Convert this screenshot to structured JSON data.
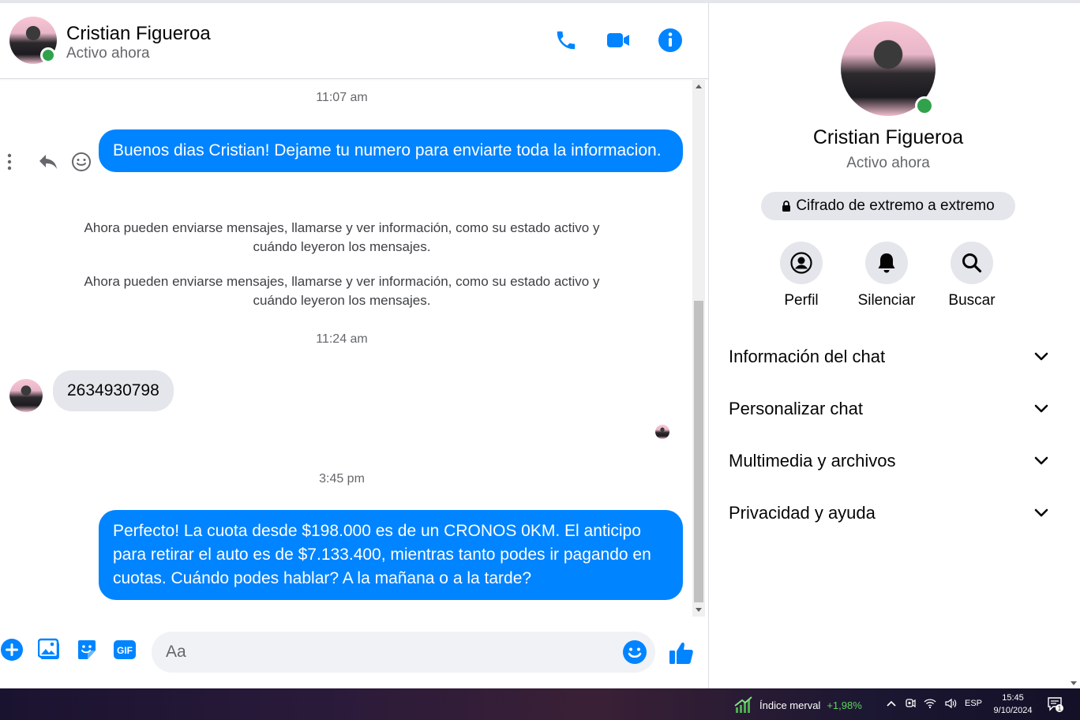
{
  "header": {
    "name": "Cristian Figueroa",
    "status": "Activo ahora"
  },
  "messages": {
    "ts1": "11:07 am",
    "msg1": "Buenos dias Cristian! Dejame tu numero para enviarte toda la informacion.",
    "sys1": "Ahora pueden enviarse mensajes, llamarse y ver información, como su estado activo y cuándo leyeron los mensajes.",
    "sys2": "Ahora pueden enviarse mensajes, llamarse y ver información, como su estado activo y cuándo leyeron los mensajes.",
    "ts2": "11:24 am",
    "msg2": "2634930798",
    "ts3": "3:45 pm",
    "msg3": "Perfecto! La cuota desde $198.000 es de un CRONOS 0KM. El anticipo para retirar el auto es de $7.133.400, mientras tanto podes ir pagando en cuotas. Cuándo podes hablar? A la mañana o a la tarde?"
  },
  "composer": {
    "placeholder": "Aa"
  },
  "info": {
    "name": "Cristian Figueroa",
    "status": "Activo ahora",
    "encryption": "Cifrado de extremo a extremo",
    "actions": [
      {
        "label": "Perfil",
        "icon": "profile-icon"
      },
      {
        "label": "Silenciar",
        "icon": "bell-icon"
      },
      {
        "label": "Buscar",
        "icon": "search-icon"
      }
    ],
    "sections": [
      {
        "label": "Información del chat"
      },
      {
        "label": "Personalizar chat"
      },
      {
        "label": "Multimedia y archivos"
      },
      {
        "label": "Privacidad y ayuda"
      }
    ]
  },
  "taskbar": {
    "ticker_name": "Índice merval",
    "ticker_change": "+1,98%",
    "lang": "ESP",
    "time": "15:45",
    "date": "9/10/2024",
    "notif_count": "1"
  },
  "colors": {
    "accent": "#0084ff",
    "online": "#31a24c",
    "incoming_bubble": "#e4e6eb"
  }
}
